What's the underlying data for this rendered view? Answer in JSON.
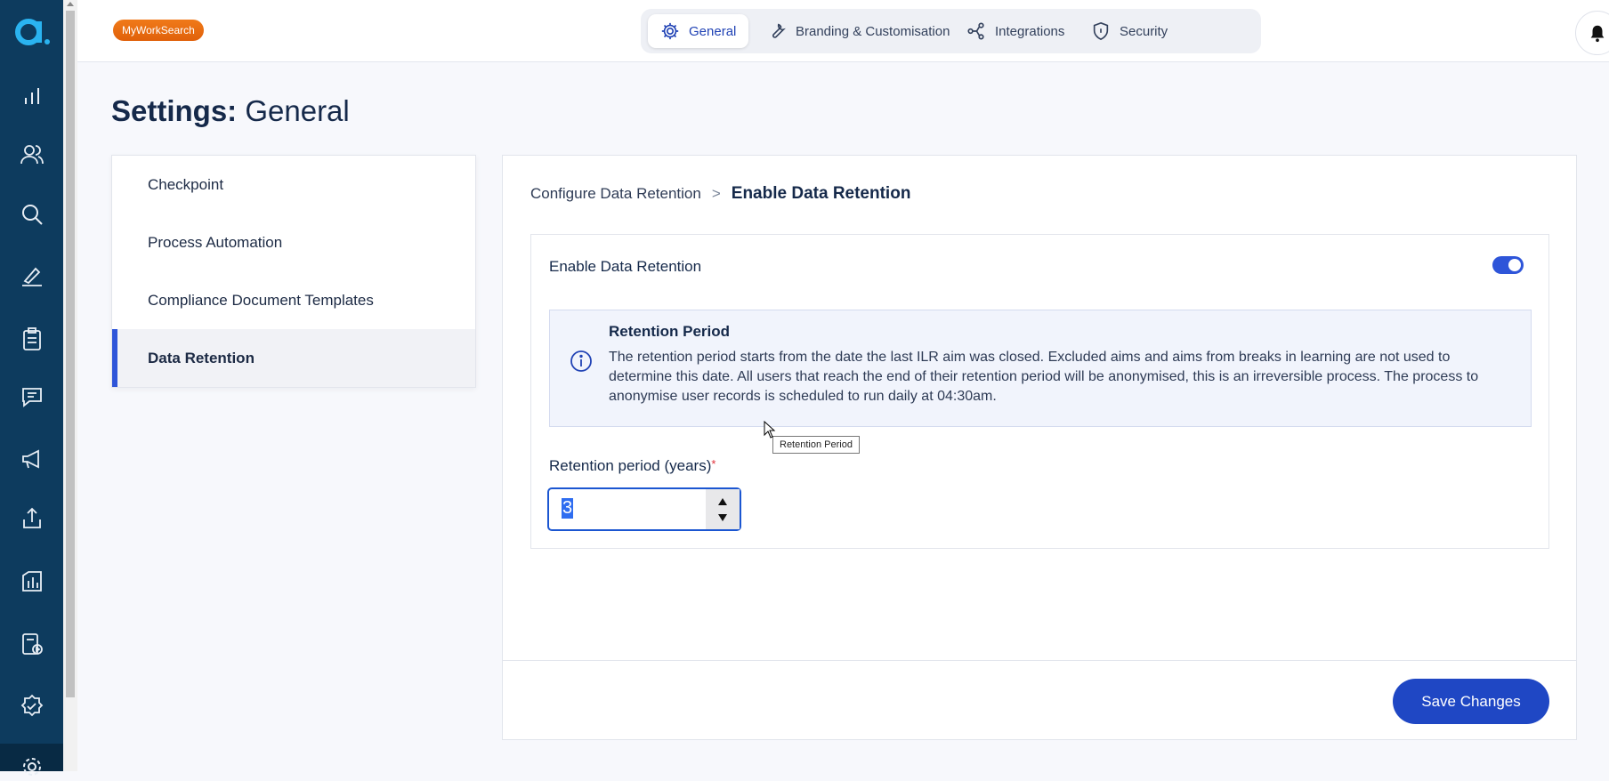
{
  "app": {
    "brand_badge": "MyWorkSearch"
  },
  "tabs": [
    {
      "label": "General",
      "icon": "gear-icon",
      "active": true
    },
    {
      "label": "Branding & Customisation",
      "icon": "wrench-icon",
      "active": false
    },
    {
      "label": "Integrations",
      "icon": "share-nodes-icon",
      "active": false
    },
    {
      "label": "Security",
      "icon": "shield-icon",
      "active": false
    }
  ],
  "page": {
    "title_bold": "Settings:",
    "title_rest": "General"
  },
  "settings_menu": {
    "items": [
      {
        "label": "Checkpoint",
        "active": false
      },
      {
        "label": "Process Automation",
        "active": false
      },
      {
        "label": "Compliance Document Templates",
        "active": false
      },
      {
        "label": "Data Retention",
        "active": true
      }
    ]
  },
  "breadcrumb": {
    "parent": "Configure Data Retention",
    "separator": ">",
    "current": "Enable Data Retention"
  },
  "data_retention": {
    "toggle_label": "Enable Data Retention",
    "toggle_on": true,
    "info_title": "Retention Period",
    "info_text": "The retention period starts from the date the last ILR aim was closed. Excluded aims and aims from breaks in learning are not used to determine this date. All users that reach the end of their retention period will be anonymised, this is an irreversible process. The process to anonymise user records is scheduled to run daily at 04:30am.",
    "field_label": "Retention period (years)",
    "required_mark": "*",
    "field_value": "3"
  },
  "actions": {
    "save_label": "Save Changes"
  },
  "tooltip": {
    "text": "Retention Period"
  },
  "colors": {
    "nav_bg": "#0d3b5e",
    "accent": "#2e55d9",
    "primary_button": "#1f47c4",
    "brand_orange": "#f07a19"
  }
}
